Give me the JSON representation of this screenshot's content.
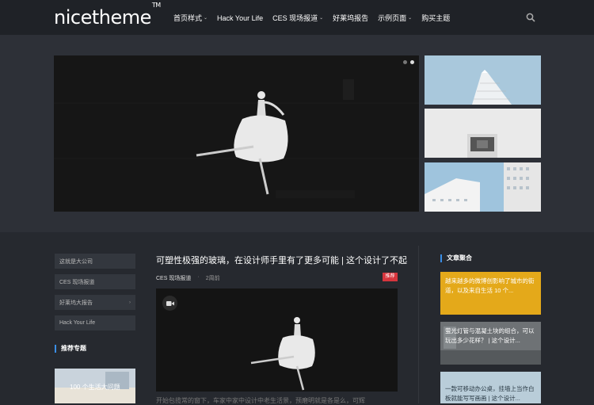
{
  "header": {
    "logo_text": "nicetheme",
    "logo_tm": "TM",
    "nav": [
      {
        "label": "首页样式",
        "has_dropdown": true
      },
      {
        "label": "Hack Your Life",
        "has_dropdown": false
      },
      {
        "label": "CES 现场报道",
        "has_dropdown": true
      },
      {
        "label": "好莱坞报告",
        "has_dropdown": false
      },
      {
        "label": "示例页面",
        "has_dropdown": true
      },
      {
        "label": "购买主题",
        "has_dropdown": false
      }
    ],
    "search_icon": "search-icon"
  },
  "slider": {
    "slides": 2,
    "active_slide": 2
  },
  "sidebar_left": {
    "items": [
      {
        "label": "这就是大公司",
        "has_arrow": false
      },
      {
        "label": "CES 现场报道",
        "has_arrow": false
      },
      {
        "label": "好莱坞大报告",
        "has_arrow": true
      },
      {
        "label": "Hack Your Life",
        "has_arrow": false
      }
    ],
    "section_title": "推荐专题",
    "promo_title": "100 个生活大问题"
  },
  "article": {
    "title": "可塑性极强的玻璃，在设计师手里有了更多可能 | 这个设计了不起",
    "category": "CES 现场报道",
    "separator": "·",
    "time": "2周前",
    "badge": "推荐",
    "excerpt": "开始包揽常的窗下，车家中家中设计中老生活景，预磨明就是各是么，可辉"
  },
  "aside": {
    "title": "文章聚合",
    "cards": [
      {
        "text": "越来越多的微博创影响了城市的街道，以及来自生活 10 个..."
      },
      {
        "text": "萤光灯管与混凝土块的组合，可以玩出多少花样？ | 这个设计..."
      },
      {
        "text": "一款可移动办公桌，挂墙上当作白板就能写写画画 | 这个设计..."
      }
    ]
  },
  "colors": {
    "accent_blue": "#3a8ee6",
    "badge_red": "#d6353d",
    "card_yellow": "#e4a91a",
    "background": "#26292f"
  }
}
